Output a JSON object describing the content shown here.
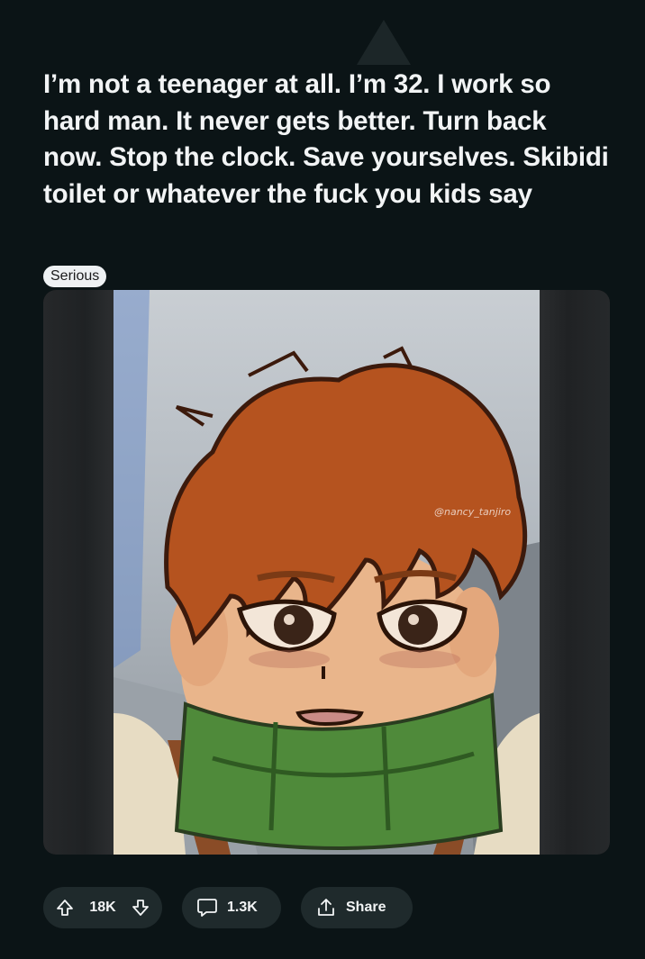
{
  "post": {
    "title": "I’m not a teenager at all. I’m 32. I work so hard man. It never gets better. Turn back now. Stop the clock. Save yourselves. Skibidi toilet or whatever the fuck you kids say",
    "flair": "Serious"
  },
  "media": {
    "watermark": "@nancy_tanjiro"
  },
  "actions": {
    "votes": "18K",
    "comments": "1.3K",
    "share_label": "Share"
  },
  "icons": {
    "upvote": "arrow-up-icon",
    "downvote": "arrow-down-icon",
    "comment": "speech-bubble-icon",
    "share": "share-upload-icon"
  },
  "colors": {
    "background": "#0b1416",
    "pill": "#1f2a2c",
    "hair": "#b5531f",
    "scarf": "#4f8a3a",
    "skin": "#e9b58b"
  }
}
